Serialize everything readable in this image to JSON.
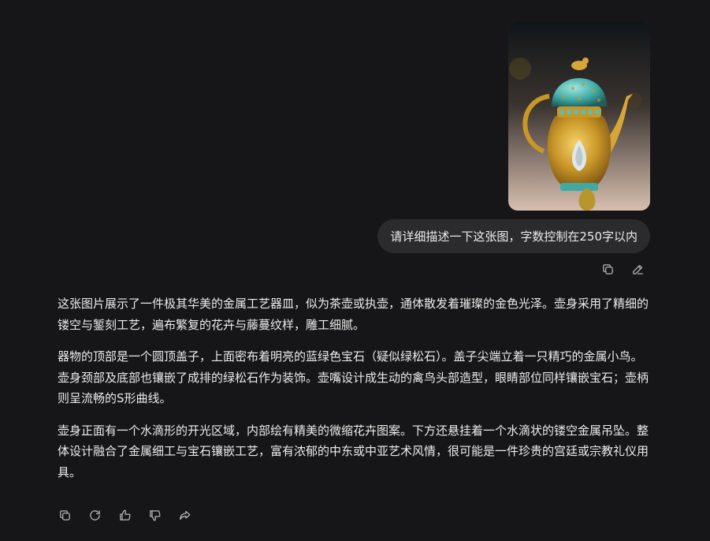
{
  "attachment": {
    "subject": "jeweled golden ewer photo"
  },
  "user_message": {
    "text": "请详细描述一下这张图，字数控制在250字以内"
  },
  "user_actions": {
    "copy_icon": "copy-icon",
    "edit_icon": "edit-icon"
  },
  "reply": {
    "paragraphs": [
      "这张图片展示了一件极其华美的金属工艺器皿，似为茶壶或执壶，通体散发着璀璨的金色光泽。壶身采用了精细的镂空与錾刻工艺，遍布繁复的花卉与藤蔓纹样，雕工细腻。",
      "器物的顶部是一个圆顶盖子，上面密布着明亮的蓝绿色宝石（疑似绿松石）。盖子尖端立着一只精巧的金属小鸟。壶身颈部及底部也镶嵌了成排的绿松石作为装饰。壶嘴设计成生动的禽鸟头部造型，眼睛部位同样镶嵌宝石；壶柄则呈流畅的S形曲线。",
      "壶身正面有一个水滴形的开光区域，内部绘有精美的微缩花卉图案。下方还悬挂着一个水滴状的镂空金属吊坠。整体设计融合了金属细工与宝石镶嵌工艺，富有浓郁的中东或中亚艺术风情，很可能是一件珍贵的宫廷或宗教礼仪用具。"
    ]
  },
  "reply_actions": [
    "copy-icon",
    "regenerate-icon",
    "thumbs-up-icon",
    "thumbs-down-icon",
    "share-icon"
  ]
}
